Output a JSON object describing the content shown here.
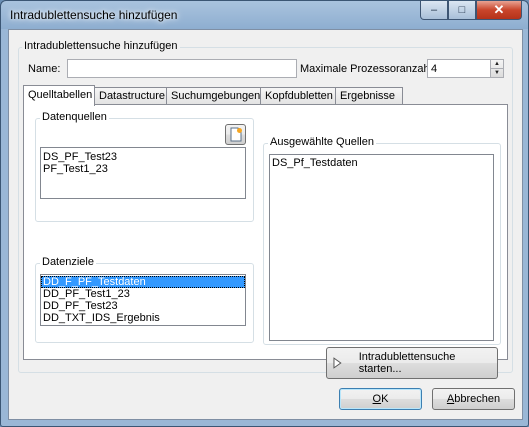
{
  "window": {
    "title": "Intradublettensuche hinzufügen"
  },
  "caption": {
    "minimize": "–",
    "maximize": "□",
    "close": "✕"
  },
  "header_group": {
    "label": "Intradublettensuche hinzufügen",
    "name_label": "Name:",
    "name_value": "",
    "max_label": "Maximale Prozessoranzahl",
    "max_value": "4"
  },
  "tabs": [
    "Quelltabellen",
    "Datastructure",
    "Suchumgebungen",
    "Kopfdubletten",
    "Ergebnisse"
  ],
  "datenquellen": {
    "label": "Datenquellen",
    "items": [
      "DS_PF_Test23",
      "PF_Test1_23"
    ]
  },
  "datenziele": {
    "label": "Datenziele",
    "items": [
      "DD_F_PF_Testdaten",
      "DD_PF_Test1_23",
      "DD_PF_Test23",
      "DD_TXT_IDS_Ergebnis"
    ],
    "selected": "DD_F_PF_Testdaten"
  },
  "ausgewaehlte": {
    "label": "Ausgewählte Quellen",
    "items": [
      "DS_Pf_Testdaten"
    ]
  },
  "start_button": "Intradublettensuche starten...",
  "ok_button": "OK",
  "cancel_button": "Abbrechen",
  "icons": {
    "new_source": "new-document-icon",
    "start": "play-triangle-icon"
  }
}
